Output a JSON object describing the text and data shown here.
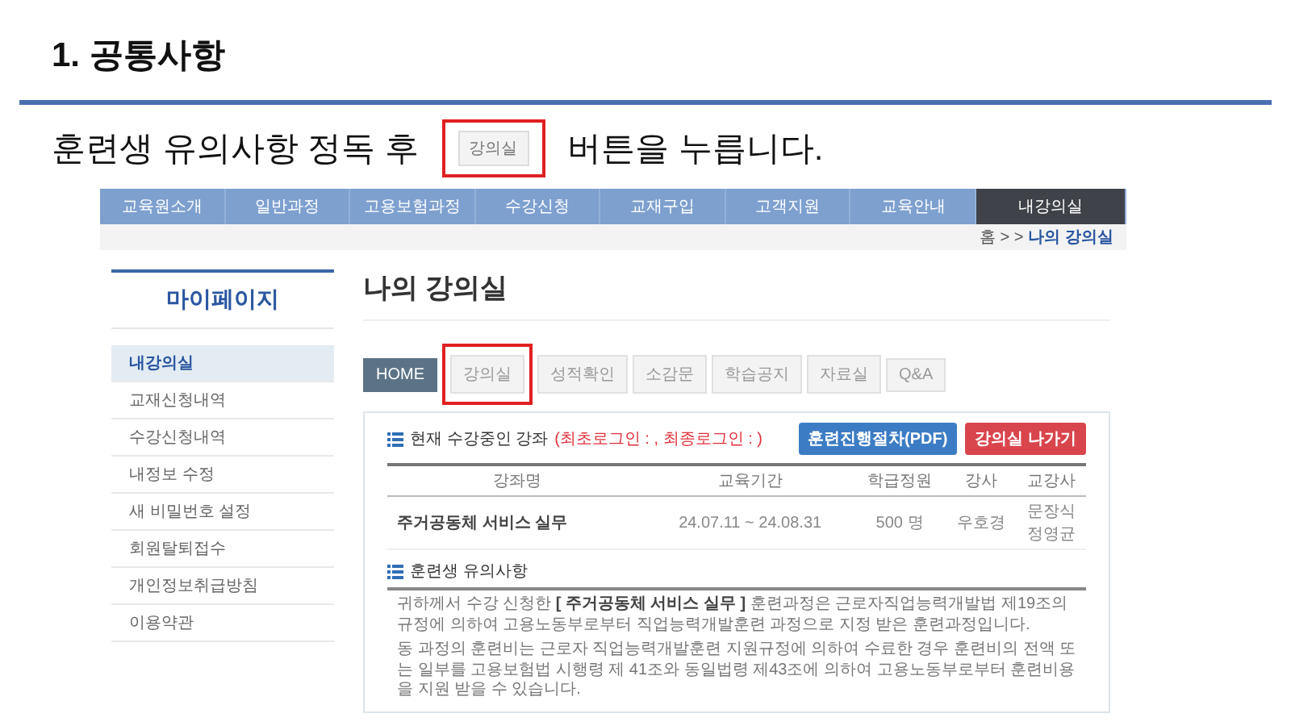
{
  "section_title": "1. 공통사항",
  "instruction": {
    "before": "훈련생 유의사항 정독 후",
    "button_label": "강의실",
    "button_highlighted": true,
    "after": "버튼을 누릅니다."
  },
  "site": {
    "nav": [
      {
        "label": "교육원소개",
        "selected": false
      },
      {
        "label": "일반과정",
        "selected": false
      },
      {
        "label": "고용보험과정",
        "selected": false
      },
      {
        "label": "수강신청",
        "selected": false
      },
      {
        "label": "교재구입",
        "selected": false
      },
      {
        "label": "고객지원",
        "selected": false
      },
      {
        "label": "교육안내",
        "selected": false
      },
      {
        "label": "내강의실",
        "selected": true
      }
    ],
    "breadcrumb": {
      "home": "홈",
      "separator": "> >",
      "current": "나의 강의실"
    },
    "sidebar": {
      "title": "마이페이지",
      "items": [
        {
          "label": "내강의실",
          "selected": true
        },
        {
          "label": "교재신청내역",
          "selected": false
        },
        {
          "label": "수강신청내역",
          "selected": false
        },
        {
          "label": "내정보 수정",
          "selected": false
        },
        {
          "label": "새 비밀번호 설정",
          "selected": false
        },
        {
          "label": "회원탈퇴접수",
          "selected": false
        },
        {
          "label": "개인정보취급방침",
          "selected": false
        },
        {
          "label": "이용약관",
          "selected": false
        }
      ]
    },
    "page_title": "나의 강의실",
    "tabs": [
      {
        "label": "HOME",
        "selected": true,
        "highlighted": false
      },
      {
        "label": "강의실",
        "selected": false,
        "highlighted": true
      },
      {
        "label": "성적확인",
        "selected": false,
        "highlighted": false
      },
      {
        "label": "소감문",
        "selected": false,
        "highlighted": false
      },
      {
        "label": "학습공지",
        "selected": false,
        "highlighted": false
      },
      {
        "label": "자료실",
        "selected": false,
        "highlighted": false
      },
      {
        "label": "Q&A",
        "selected": false,
        "highlighted": false
      }
    ],
    "current_courses": {
      "heading": "현재 수강중인 강좌",
      "login_info": "(최초로그인 : , 최종로그인 : )",
      "buttons": [
        {
          "label": "훈련진행절차(PDF)",
          "kind": "primary"
        },
        {
          "label": "강의실 나가기",
          "kind": "danger"
        }
      ],
      "columns": [
        "강좌명",
        "교육기간",
        "학급정원",
        "강사",
        "교강사"
      ],
      "rows": [
        {
          "course": "주거공동체 서비스 실무",
          "period": "24.07.11 ~ 24.08.31",
          "capacity": "500 명",
          "instructor": "우호경",
          "tutors": [
            "문장식",
            "정영균"
          ]
        }
      ]
    },
    "notice": {
      "heading": "훈련생 유의사항",
      "paragraphs": [
        "귀하께서 수강 신청한 **[ 주거공동체 서비스 실무 ]** 훈련과정은 근로자직업능력개발법 제19조의 규정에 의하여 고용노동부로부터 직업능력개발훈련 과정으로 지정 받은 훈련과정입니다.",
        "동 과정의 훈련비는 근로자 직업능력개발훈련 지원규정에 의하여 수료한 경우 훈련비의 전액 또는 일부를 고용보험법 시행령 제 41조와 동일법령 제43조에 의하여 고용노동부로부터 훈련비용을 지원 받을 수 있습니다."
      ]
    }
  }
}
